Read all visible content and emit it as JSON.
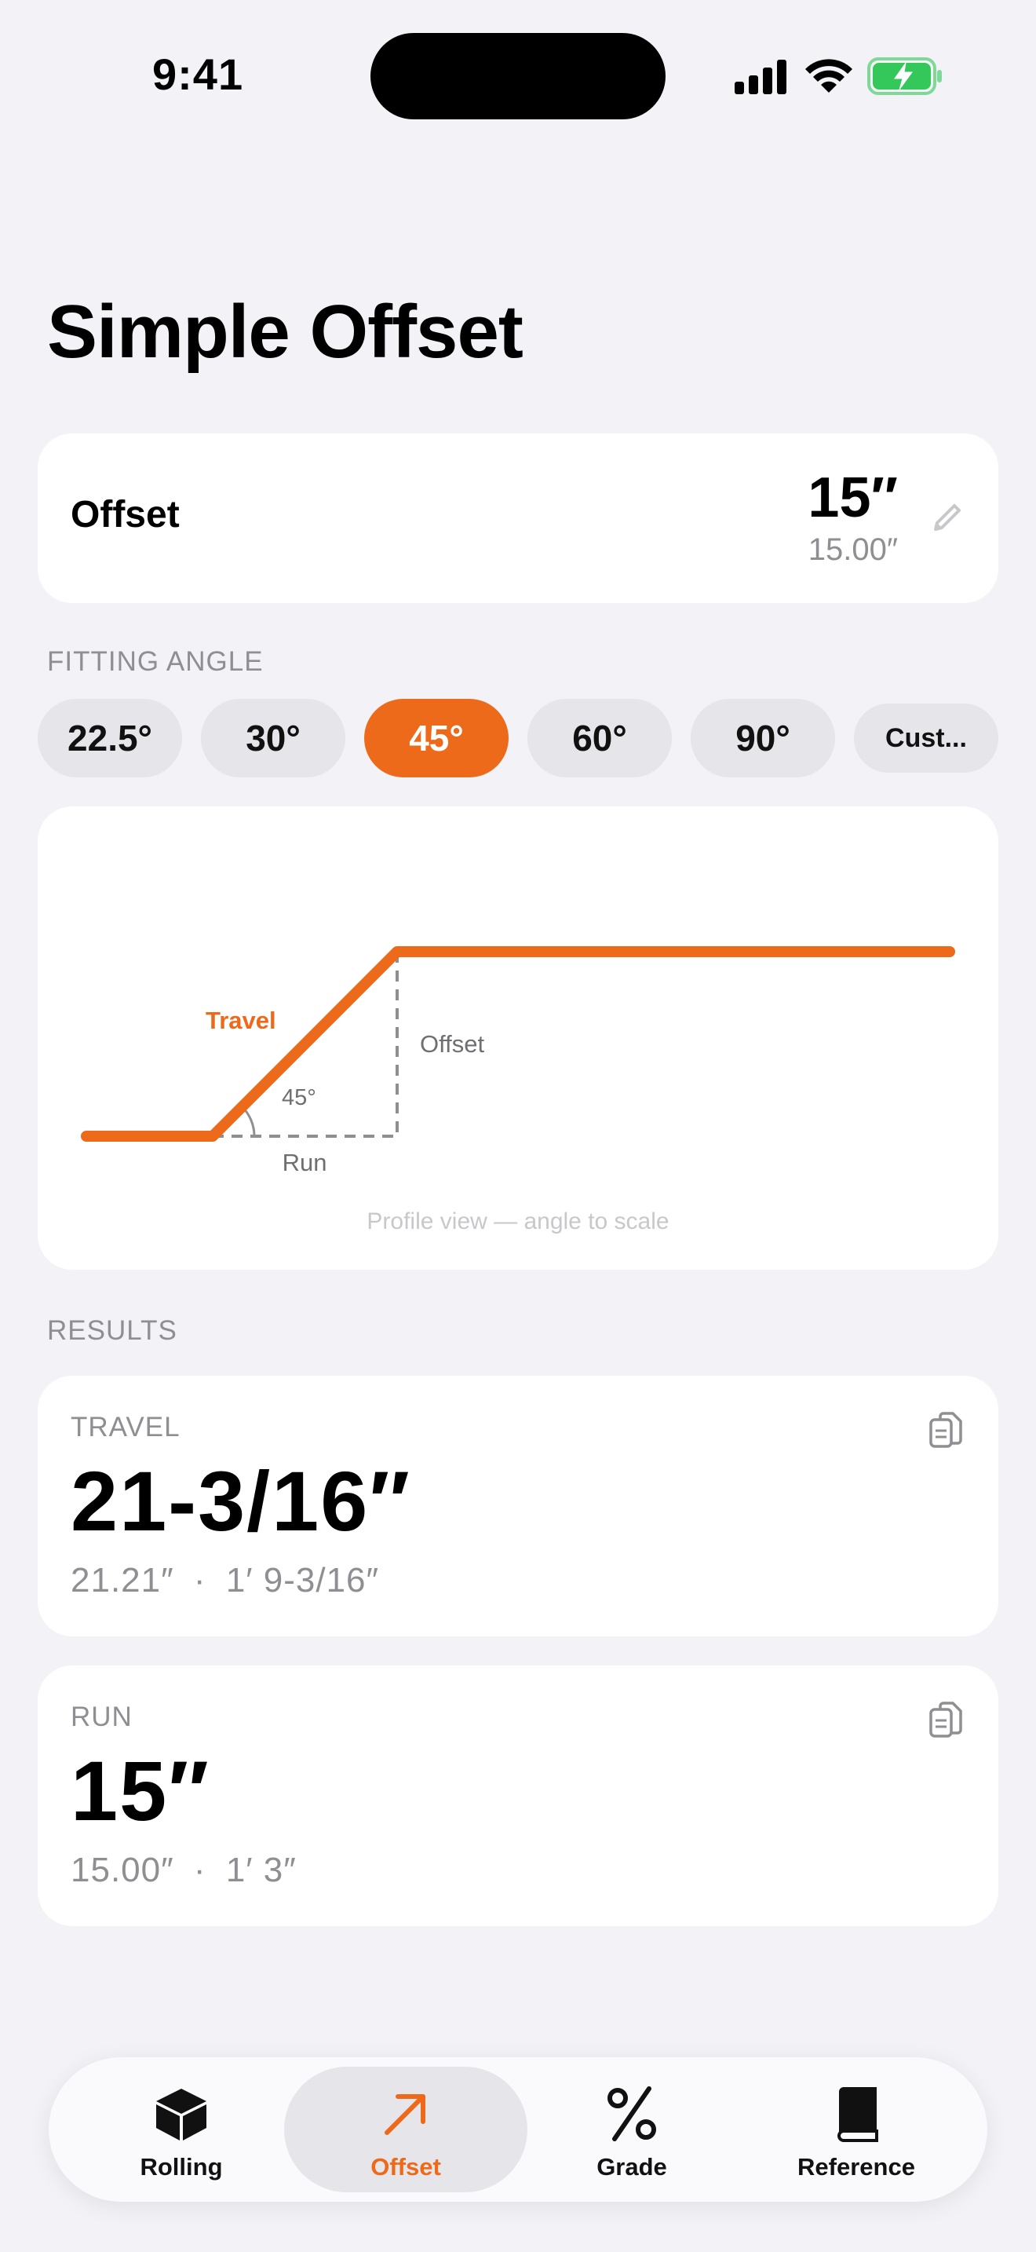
{
  "status_bar": {
    "time": "9:41"
  },
  "page": {
    "title": "Simple Offset"
  },
  "offset_input": {
    "label": "Offset",
    "value": "15″",
    "decimal": "15.00″"
  },
  "fitting_angle": {
    "header": "FITTING ANGLE",
    "options": [
      "22.5°",
      "30°",
      "45°",
      "60°",
      "90°",
      "Cust..."
    ],
    "selected": "45°"
  },
  "diagram": {
    "travel_label": "Travel",
    "offset_label": "Offset",
    "angle_label": "45°",
    "run_label": "Run",
    "caption": "Profile view — angle to scale",
    "pipe_color": "#EC6A1A"
  },
  "results": {
    "header": "RESULTS",
    "travel": {
      "label": "TRAVEL",
      "value": "21-3/16″",
      "decimal": "21.21″",
      "separator": "·",
      "feet_inches": "1′ 9-3/16″"
    },
    "run": {
      "label": "RUN",
      "value": "15″",
      "decimal": "15.00″",
      "separator": "·",
      "feet_inches": "1′ 3″"
    }
  },
  "tab_bar": {
    "tabs": [
      {
        "label": "Rolling",
        "icon": "cube-icon"
      },
      {
        "label": "Offset",
        "icon": "arrow-up-right-icon"
      },
      {
        "label": "Grade",
        "icon": "percent-icon"
      },
      {
        "label": "Reference",
        "icon": "book-icon"
      }
    ],
    "active": "Offset"
  },
  "colors": {
    "accent": "#EC6A1A",
    "background": "#F2F2F7",
    "battery": "#34C759"
  }
}
